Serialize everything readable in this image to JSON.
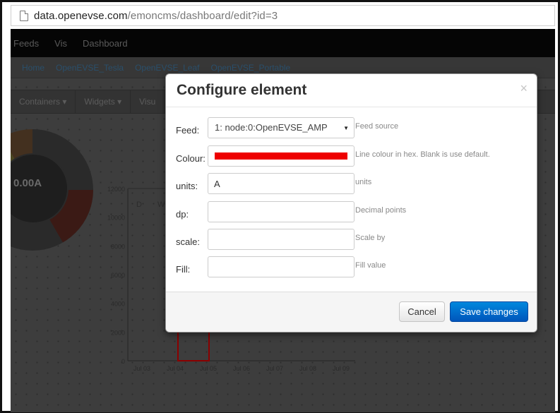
{
  "browser": {
    "url_domain": "data.openevse.com",
    "url_path": "/emoncms/dashboard/edit?id=3"
  },
  "background_page": {
    "nav_items": [
      "Feeds",
      "Vis",
      "Dashboard"
    ],
    "dashboard_tabs": [
      "Home",
      "OpenEVSE_Tesla",
      "OpenEVSE_Leaf",
      "OpenEVSE_Portable"
    ],
    "tools": [
      "Containers ▾",
      "Widgets ▾",
      "Visu"
    ],
    "gauge_value": "0.00A",
    "chart_data": {
      "type": "bar",
      "categories": [
        "Jul 03",
        "Jul 04",
        "Jul 05",
        "Jul 06",
        "Jul 07",
        "Jul 08",
        "Jul 09"
      ],
      "values": [
        0,
        9000,
        0,
        0,
        0,
        0,
        0
      ],
      "yticks": [
        "0",
        "2000",
        "4000",
        "6000",
        "8000",
        "10000",
        "12000"
      ],
      "ylim": [
        0,
        12000
      ],
      "top_labels": [
        "D",
        "W"
      ],
      "color": "#8b0000"
    }
  },
  "modal": {
    "title": "Configure element",
    "close_glyph": "×",
    "fields": {
      "feed": {
        "label": "Feed:",
        "value": "1: node:0:OpenEVSE_AMP",
        "caret": "▼",
        "hint": "Feed source"
      },
      "colour": {
        "label": "Colour:",
        "value_color": "#ee0000",
        "hint": "Line colour in hex. Blank is use default."
      },
      "units": {
        "label": "units:",
        "value": "A",
        "hint": "units"
      },
      "dp": {
        "label": "dp:",
        "value": "",
        "hint": "Decimal points"
      },
      "scale": {
        "label": "scale:",
        "value": "",
        "hint": "Scale by"
      },
      "fill": {
        "label": "Fill:",
        "value": "",
        "hint": "Fill value"
      }
    },
    "buttons": {
      "cancel": "Cancel",
      "save": "Save changes"
    }
  }
}
